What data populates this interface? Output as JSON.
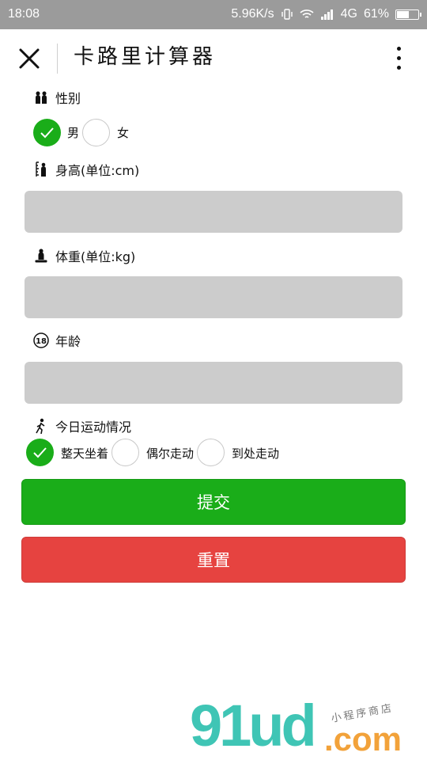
{
  "status_bar": {
    "time": "18:08",
    "speed": "5.96K/s",
    "network": "4G",
    "battery": "61%",
    "battery_level": 0.61
  },
  "nav": {
    "title": "卡路里计算器",
    "close_icon": "close-icon",
    "more_icon": "more-vertical-icon"
  },
  "form": {
    "gender": {
      "label": "性别",
      "icon": "people-icon",
      "options": [
        {
          "label": "男",
          "checked": true
        },
        {
          "label": "女",
          "checked": false
        }
      ]
    },
    "height": {
      "label": "身高(单位:cm)",
      "icon": "height-measure-icon",
      "value": ""
    },
    "weight": {
      "label": "体重(单位:kg)",
      "icon": "scale-person-icon",
      "value": ""
    },
    "age": {
      "label": "年龄",
      "icon": "age-18-icon",
      "badge": "18",
      "value": ""
    },
    "activity": {
      "label": "今日运动情况",
      "icon": "walking-person-icon",
      "options": [
        {
          "label": "整天坐着",
          "checked": true
        },
        {
          "label": "偶尔走动",
          "checked": false
        },
        {
          "label": "到处走动",
          "checked": false
        }
      ]
    }
  },
  "buttons": {
    "submit": "提交",
    "reset": "重置"
  },
  "colors": {
    "primary": "#1aad19",
    "warn": "#e64340",
    "input_bg": "#cccccc"
  },
  "watermark": {
    "logo": "91ud",
    "domain": ".com",
    "tagline": "小程序商店"
  }
}
